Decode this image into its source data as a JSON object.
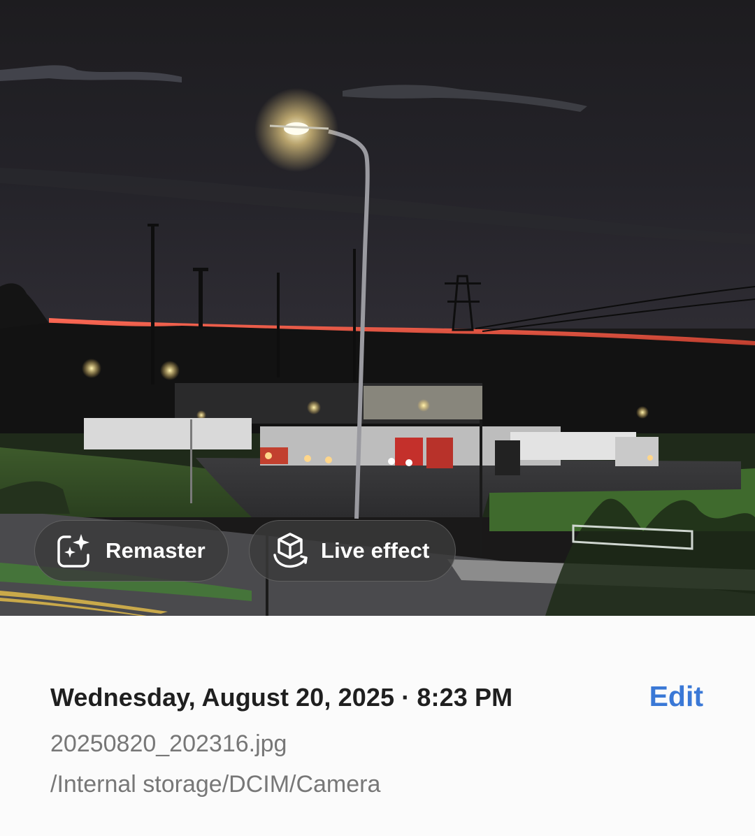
{
  "photo": {
    "description_icon": "photo-image",
    "actions": [
      {
        "icon": "sparkle-frame-icon",
        "label": "Remaster"
      },
      {
        "icon": "cube-rotate-icon",
        "label": "Live effect"
      }
    ]
  },
  "details": {
    "datetime": "Wednesday, August 20, 2025 · 8:23 PM",
    "edit_label": "Edit",
    "filename": "20250820_202316.jpg",
    "path": "/Internal storage/DCIM/Camera"
  },
  "colors": {
    "accent": "#3a78d6",
    "primary_text": "#1f1f1f",
    "secondary_text": "#777777",
    "chip_bg": "#3a3a3a"
  }
}
